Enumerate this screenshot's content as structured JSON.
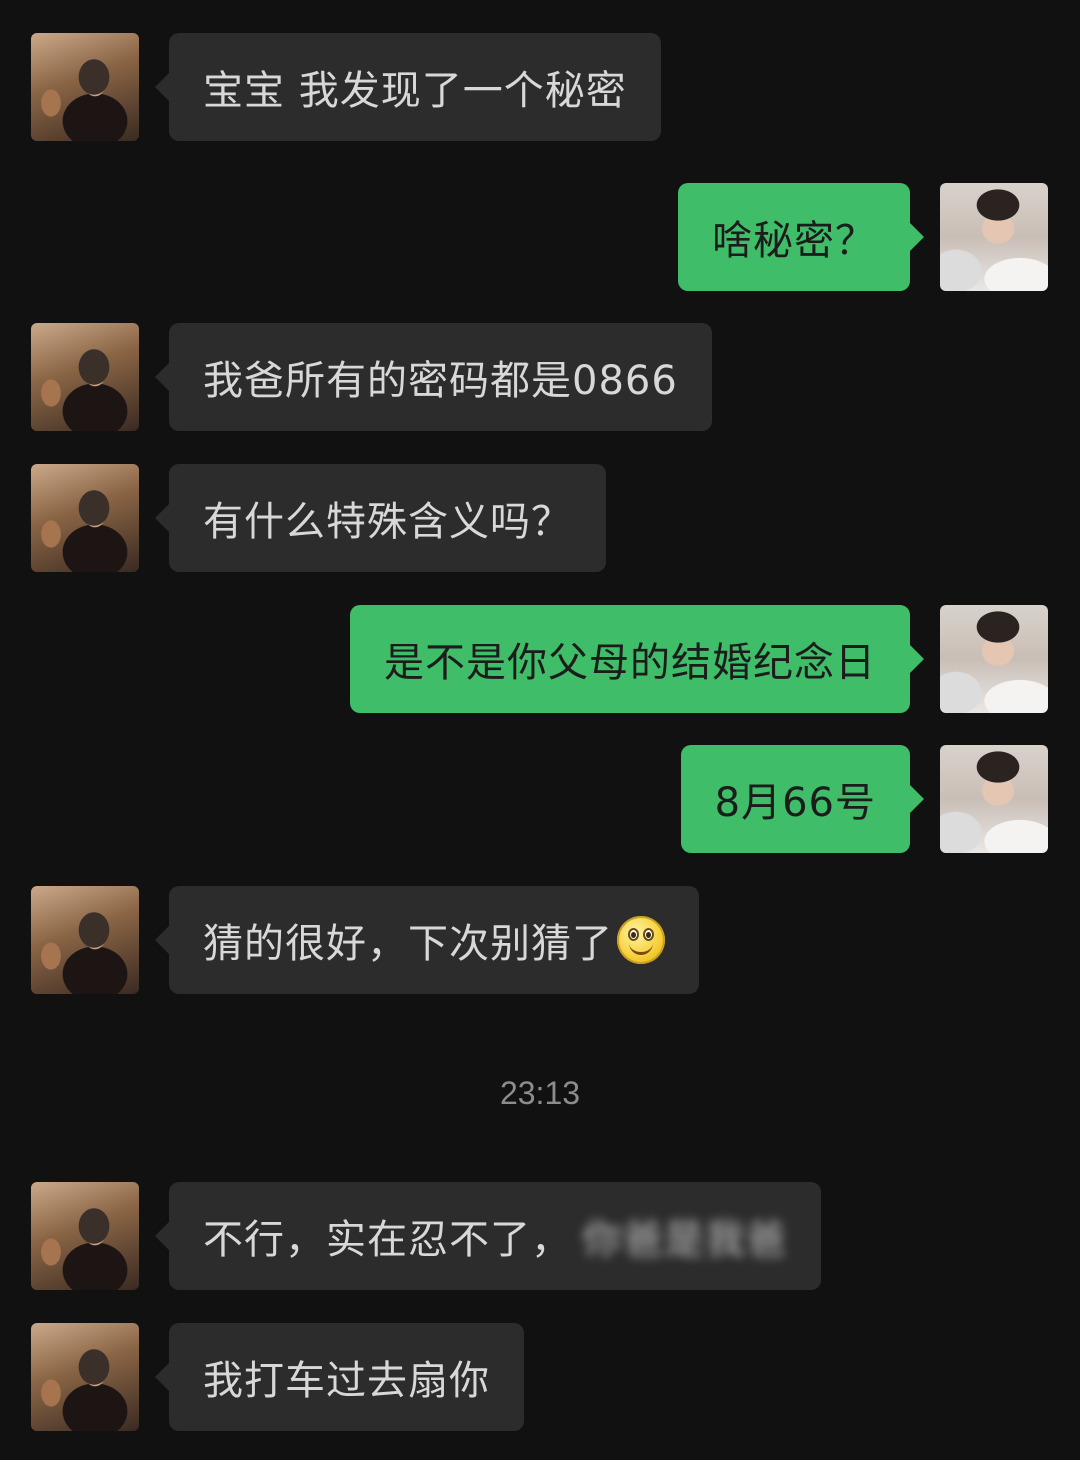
{
  "chat": {
    "timestamp": "23:13",
    "messages": [
      {
        "side": "left",
        "text": "宝宝 我发现了一个秘密"
      },
      {
        "side": "right",
        "text": "啥秘密？"
      },
      {
        "side": "left",
        "text": "我爸所有的密码都是0866"
      },
      {
        "side": "left",
        "text": "有什么特殊含义吗？"
      },
      {
        "side": "right",
        "text": "是不是你父母的结婚纪念日"
      },
      {
        "side": "right",
        "text": "8月66号"
      },
      {
        "side": "left",
        "text": "猜的很好，下次别猜了",
        "emoji": "smiley-emoji"
      },
      {
        "side": "left",
        "text": "不行，实在忍不了，",
        "blurred_text": "你爸是我爸"
      },
      {
        "side": "left",
        "text": "我打车过去扇你"
      }
    ]
  },
  "icons": {
    "left_avatar": "girlfriend-avatar",
    "right_avatar": "user-avatar"
  },
  "colors": {
    "background": "#111111",
    "incoming_bubble": "#2c2c2c",
    "outgoing_bubble": "#3fbd68",
    "timestamp_text": "#8d8d8d"
  }
}
